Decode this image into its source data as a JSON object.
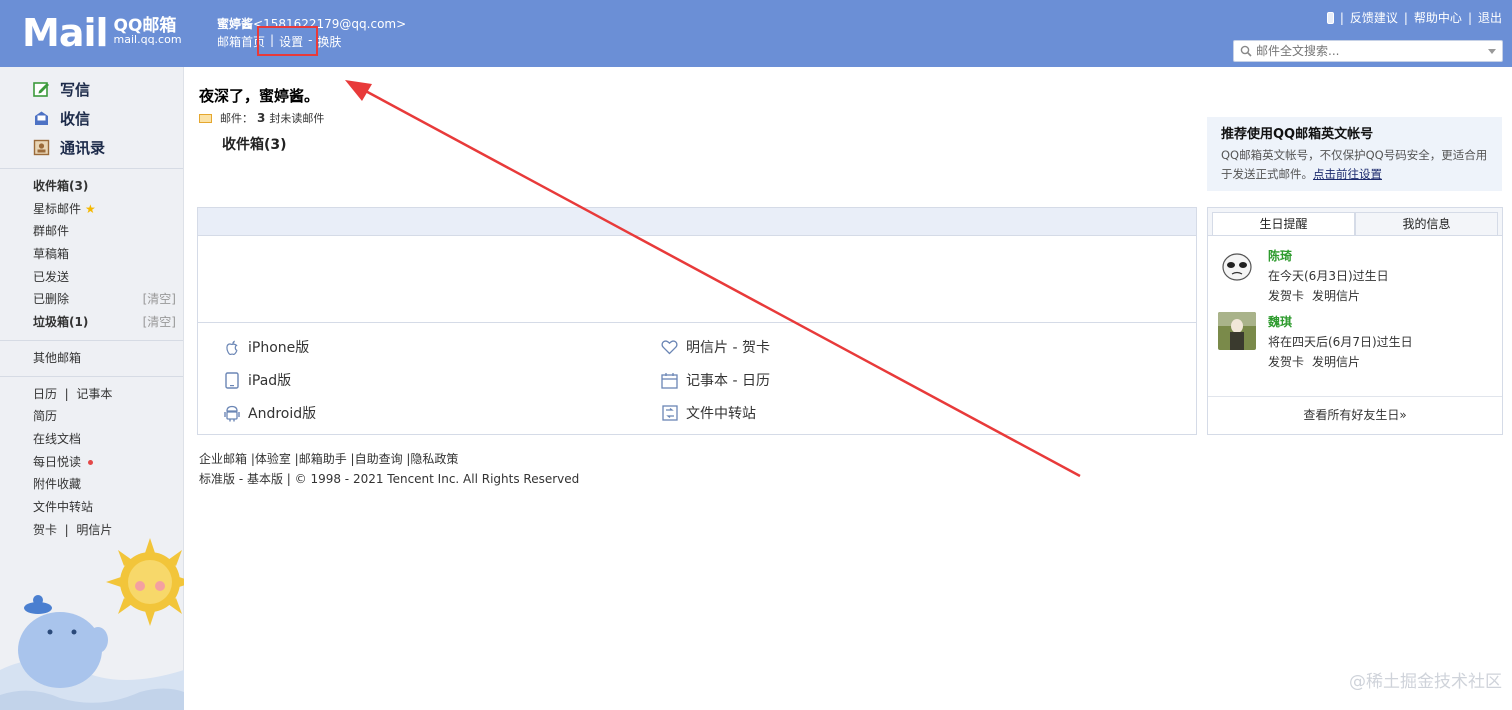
{
  "header": {
    "logo_main": "Mail",
    "logo_qq": "QQ邮箱",
    "logo_url": "mail.qq.com",
    "user_name": "蜜婷酱",
    "user_email": "<1581622179@qq.com>",
    "nav": [
      "邮箱首页",
      "|",
      "设置",
      "-",
      "换肤"
    ],
    "right_links": [
      "反馈建议",
      "帮助中心",
      "退出"
    ],
    "search_placeholder": "邮件全文搜索..."
  },
  "sidebar": {
    "big_items": [
      {
        "label": "写信",
        "icon": "compose-icon"
      },
      {
        "label": "收信",
        "icon": "inbox-icon"
      },
      {
        "label": "通讯录",
        "icon": "contacts-icon"
      }
    ],
    "folders": [
      {
        "label": "收件箱(3)",
        "bold": true
      },
      {
        "label": "星标邮件",
        "star": true
      },
      {
        "label": "群邮件"
      },
      {
        "label": "草稿箱"
      },
      {
        "label": "已发送"
      },
      {
        "label": "已删除",
        "action": "[清空]"
      },
      {
        "label": "垃圾箱(1)",
        "bold": true,
        "action": "[清空]"
      }
    ],
    "other": "其他邮箱",
    "tools": [
      {
        "a": "日历",
        "b": "记事本"
      },
      {
        "a": "简历"
      },
      {
        "a": "在线文档"
      },
      {
        "a": "每日悦读",
        "dot": true
      },
      {
        "a": "附件收藏"
      },
      {
        "a": "文件中转站"
      },
      {
        "a": "贺卡",
        "b": "明信片"
      }
    ]
  },
  "main": {
    "greeting": "夜深了，蜜婷酱。",
    "unread_prefix": "邮件：",
    "unread_count": "3",
    "unread_suffix": "封未读邮件",
    "inbox_label": "收件箱(3)",
    "promo": {
      "title": "推荐使用QQ邮箱英文帐号",
      "text": "QQ邮箱英文帐号，不仅保护QQ号码安全，更适合用于发送正式邮件。",
      "link": "点击前往设置"
    },
    "apps": [
      {
        "label": "iPhone版",
        "icon": "apple-icon"
      },
      {
        "label": "iPad版",
        "icon": "tablet-icon"
      },
      {
        "label": "Android版",
        "icon": "android-icon"
      },
      {
        "label": "明信片 - 贺卡",
        "icon": "heart-icon"
      },
      {
        "label": "记事本 - 日历",
        "icon": "calendar-icon"
      },
      {
        "label": "文件中转站",
        "icon": "transfer-icon"
      }
    ]
  },
  "birthday": {
    "tabs": [
      "生日提醒",
      "我的信息"
    ],
    "people": [
      {
        "name": "陈琦",
        "info": "在今天(6月3日)过生日",
        "links": [
          "发贺卡",
          "发明信片"
        ]
      },
      {
        "name": "魏琪",
        "info": "将在四天后(6月7日)过生日",
        "links": [
          "发贺卡",
          "发明信片"
        ]
      }
    ],
    "footer": "查看所有好友生日»"
  },
  "footer": {
    "links": "企业邮箱 |体验室 |邮箱助手 |自助查询 |隐私政策",
    "line2": "标准版 - 基本版 | © 1998 - 2021 Tencent Inc. All Rights Reserved"
  },
  "watermark": "@稀土掘金技术社区",
  "colors": {
    "header": "#6b8fd6",
    "sidebar": "#eef0f4",
    "highlight": "#e83a3a",
    "birthday_name": "#2e9b2e"
  }
}
